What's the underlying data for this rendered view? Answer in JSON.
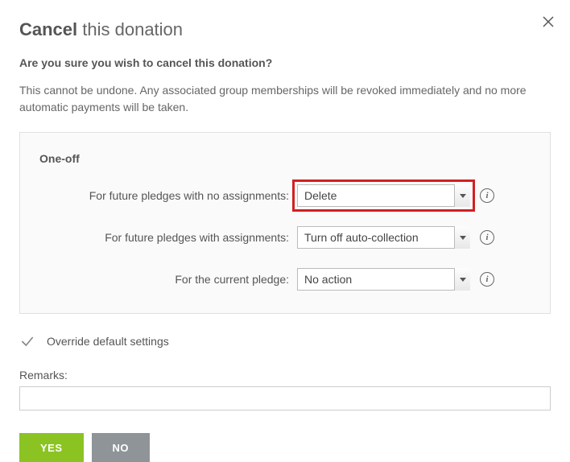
{
  "title": {
    "bold": "Cancel",
    "rest": " this donation"
  },
  "confirm_question": "Are you sure you wish to cancel this donation?",
  "warning": "This cannot be undone. Any associated group memberships will be revoked immediately and no more automatic payments will be taken.",
  "panel": {
    "heading": "One-off",
    "rows": [
      {
        "label": "For future pledges with no assignments:",
        "value": "Delete",
        "highlighted": true
      },
      {
        "label": "For future pledges with assignments:",
        "value": "Turn off auto-collection",
        "highlighted": false
      },
      {
        "label": "For the current pledge:",
        "value": "No action",
        "highlighted": false
      }
    ]
  },
  "override_label": "Override default settings",
  "remarks": {
    "label": "Remarks:",
    "value": ""
  },
  "buttons": {
    "yes": "YES",
    "no": "NO"
  }
}
